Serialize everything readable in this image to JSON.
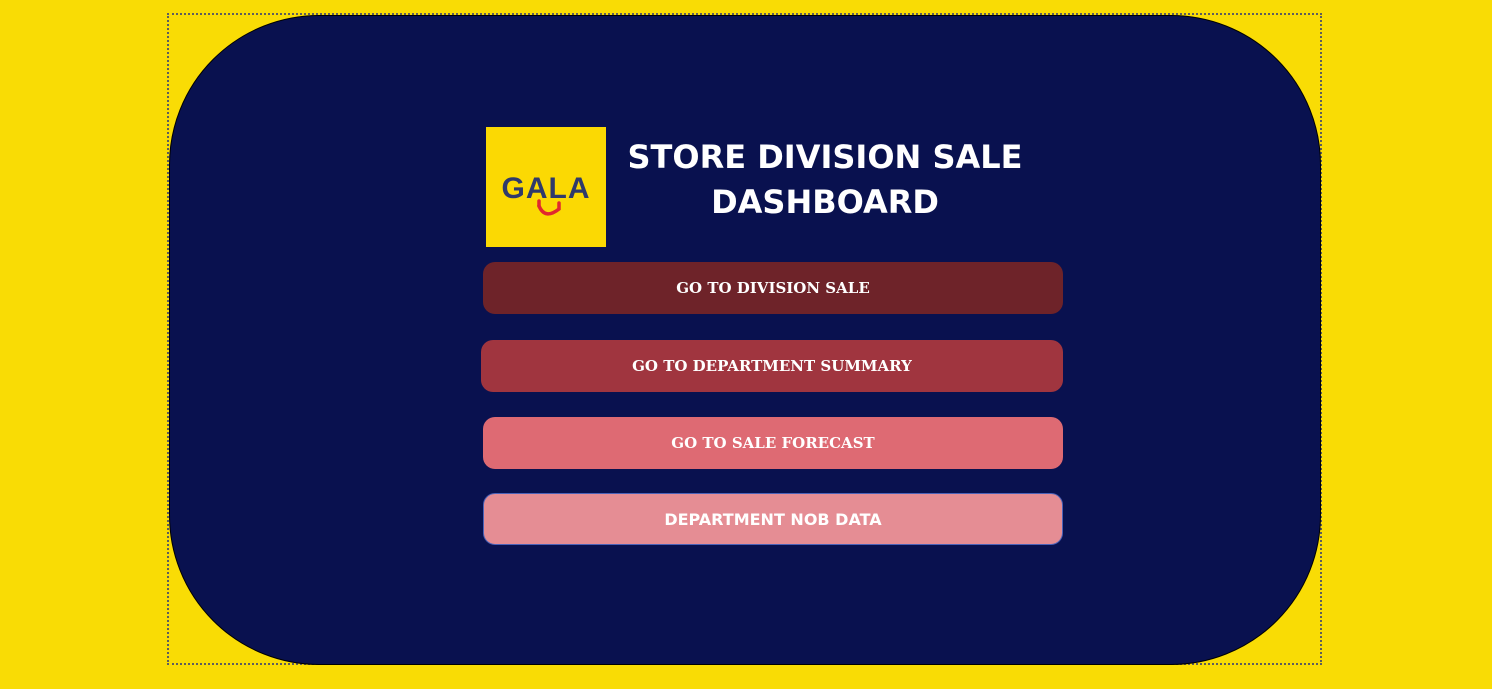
{
  "colors": {
    "background": "#f9dc05",
    "panel": "#09114f",
    "logo_background": "#fbd903",
    "logo_text": "#2f3a6b",
    "logo_smile": "#e0282e",
    "button_division": "#6e2329",
    "button_department": "#a0353f",
    "button_forecast": "#de6a73",
    "button_nob": "#e58d94",
    "button_text": "#ffffff"
  },
  "logo": {
    "text": "GALA",
    "icon": "gala-logo-icon"
  },
  "header": {
    "title_line1": "STORE DIVISION SALE",
    "title_line2": "DASHBOARD"
  },
  "nav": {
    "division_sale": "GO TO DIVISION SALE",
    "department_summary": "GO TO DEPARTMENT SUMMARY",
    "sale_forecast": "GO TO SALE FORECAST",
    "department_nob": "DEPARTMENT NOB DATA"
  }
}
